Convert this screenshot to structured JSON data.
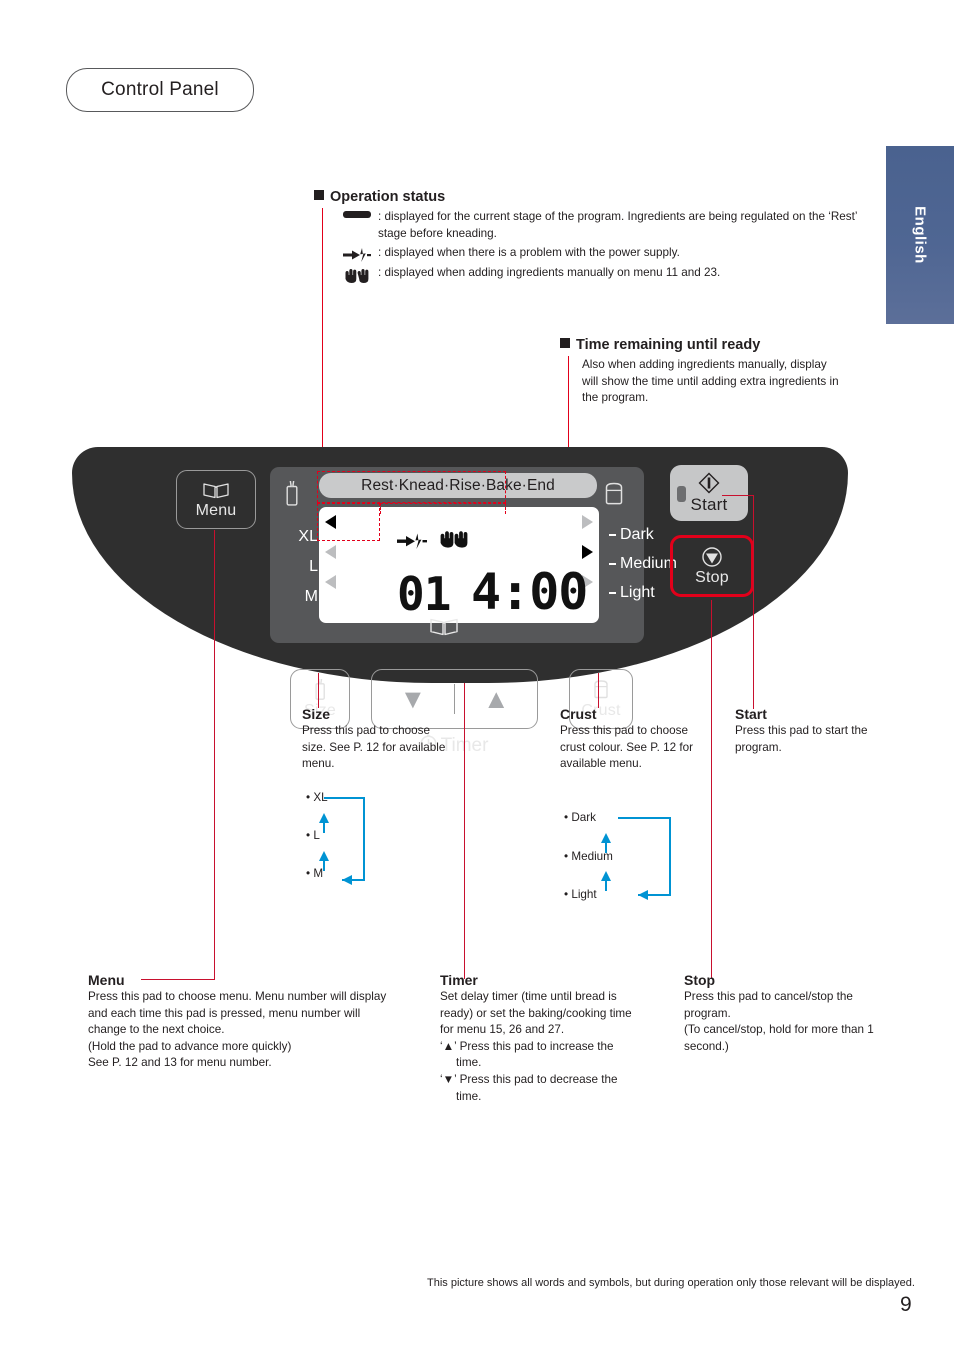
{
  "document": {
    "title": "Control Panel",
    "language_tab": "English",
    "page_number": "9",
    "footer_note": "This picture shows all words and symbols, but during operation only those relevant will be displayed."
  },
  "operation_status": {
    "heading": "Operation status",
    "items": [
      {
        "icon": "progress-bar-icon",
        "text": "displayed for the current stage of the program. Ingredients are being regulated on the ‘Rest’ stage before kneading."
      },
      {
        "icon": "power-plug-icon",
        "text": "displayed when there is a problem with the power supply."
      },
      {
        "icon": "hands-icon",
        "text": "displayed when adding ingredients manually on menu 11 and 23."
      }
    ],
    "prefix": ":"
  },
  "time_remaining": {
    "heading": "Time remaining until ready",
    "text": "Also when adding ingredients manually, display will show the time until adding extra ingredients in the program."
  },
  "control_panel": {
    "buttons": {
      "menu": "Menu",
      "size": "Size",
      "crust": "Crust",
      "start": "Start",
      "stop": "Stop",
      "timer": "Timer",
      "timer_down": "▼",
      "timer_up": "▲"
    },
    "lcd": {
      "stage_bar": "Rest·Knead·Rise·Bake·End",
      "stage_segments": [
        {
          "label": "Rest",
          "active": true
        },
        {
          "label": "Knead",
          "active": false
        },
        {
          "label": "Rise",
          "active": false
        },
        {
          "label": "Bake",
          "active": false
        },
        {
          "label": "End",
          "active": false
        }
      ],
      "menu_number": "01",
      "time_display": "4:00",
      "size_options": [
        {
          "label": "XL",
          "active": true
        },
        {
          "label": "L",
          "active": false
        },
        {
          "label": "M",
          "active": false
        }
      ],
      "crust_options": [
        {
          "label": "Dark",
          "active": false
        },
        {
          "label": "Medium",
          "active": true
        },
        {
          "label": "Light",
          "active": false
        }
      ]
    }
  },
  "annotations": {
    "size": {
      "title": "Size",
      "text": "Press this pad to choose size. See P. 12 for available menu.",
      "options": [
        "• XL",
        "• L",
        "• M"
      ]
    },
    "crust": {
      "title": "Crust",
      "text": "Press this pad to choose crust colour. See P. 12 for available menu.",
      "options": [
        "• Dark",
        "• Medium",
        "• Light"
      ]
    },
    "start": {
      "title": "Start",
      "text": "Press this pad to start the program."
    },
    "menu": {
      "title": "Menu",
      "text": "Press this pad to choose menu. Menu number will display and each time this pad is pressed, menu number will change to the next choice.\n(Hold the pad to advance more quickly)\nSee P. 12 and 13 for menu number."
    },
    "timer": {
      "title": "Timer",
      "text": "Set delay timer (time until bread is ready) or set the baking/cooking time for menu 15, 26 and 27.",
      "up_line": "‘▲’ Press this pad to increase the time.",
      "down_line": "‘▼’ Press this pad to decrease the time."
    },
    "stop": {
      "title": "Stop",
      "text": "Press this pad to cancel/stop the program.\n(To cancel/stop, hold for more than 1 second.)"
    }
  },
  "colors": {
    "accent_red": "#e2001a",
    "cycle_blue": "#0093d3",
    "panel_dark": "#2f2f2f",
    "tab_blue": "#4f6693"
  }
}
